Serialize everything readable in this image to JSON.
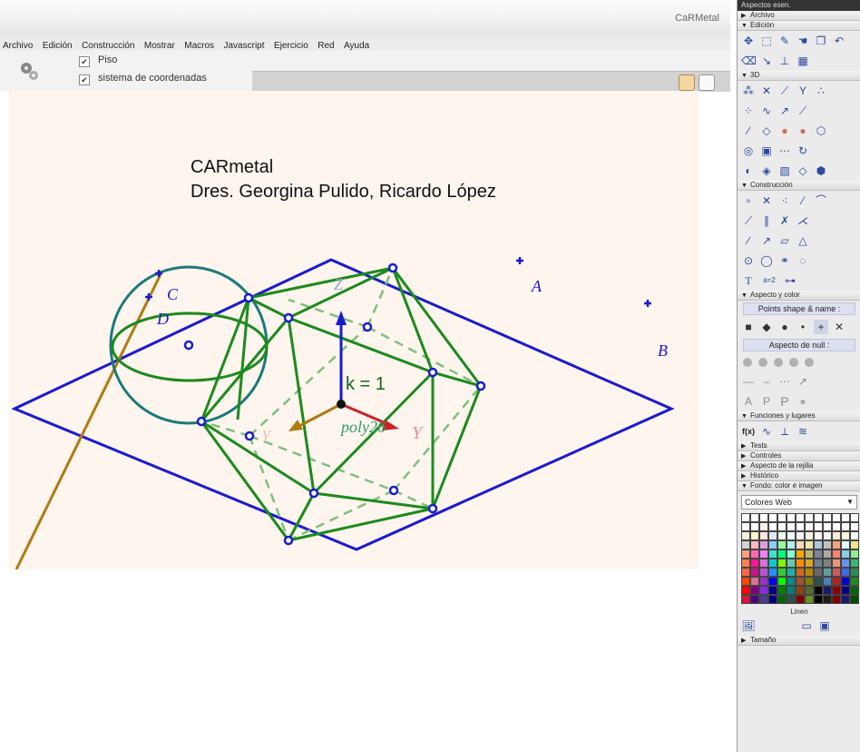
{
  "window": {
    "title": "CaRMetal"
  },
  "menu": [
    "Archivo",
    "Edición",
    "Construcción",
    "Mostrar",
    "Macros",
    "Javascript",
    "Ejercicio",
    "Red",
    "Ayuda"
  ],
  "toolbar": {
    "checkboxes": [
      {
        "label": "Piso",
        "checked": true
      },
      {
        "label": "sistema de coordenadas",
        "checked": true
      }
    ],
    "check_mark": "✔"
  },
  "canvas": {
    "title_line1": "CARmetal",
    "title_line2": "Dres. Georgina Pulido, Ricardo López",
    "labels": {
      "A": "A",
      "B": "B",
      "C": "C",
      "D": "D"
    },
    "k_label": "k = 1",
    "poly_label": "poly26",
    "axis_labels": {
      "z": "Z",
      "y": "Y",
      "x": "Y"
    },
    "colors": {
      "floor": "#1a1ad0",
      "polyhedron": "#1c8a1c",
      "sphere": "#1a7a7a",
      "line": "#b07a10",
      "point": "#1a1ad0",
      "axis_z": "#1a1ad0",
      "axis_y": "#cc2222",
      "axis_x": "#b07a10",
      "background": "#fdf5ee"
    }
  },
  "panel": {
    "title": "Aspectos esen.",
    "sections": {
      "archivo": "Archivo",
      "edicion": "Edición",
      "tres_d": "3D",
      "construccion": "Construcción",
      "aspecto": "Aspecto y color",
      "points_shape": "Points shape & name :",
      "aspecto_null": "Aspecto de null :",
      "funciones": "Funciones y lugares",
      "tests": "Tests",
      "controles": "Controles",
      "rejilla": "Aspecto de la rejilla",
      "historico": "Histórico",
      "fondo": "Fondo: color e imagen",
      "tamano": "Tamaño"
    },
    "color_select": "Colores Web",
    "linen": "Linen",
    "fx_label": "f(x)",
    "t_label": "T",
    "ab_label": "a=2"
  }
}
